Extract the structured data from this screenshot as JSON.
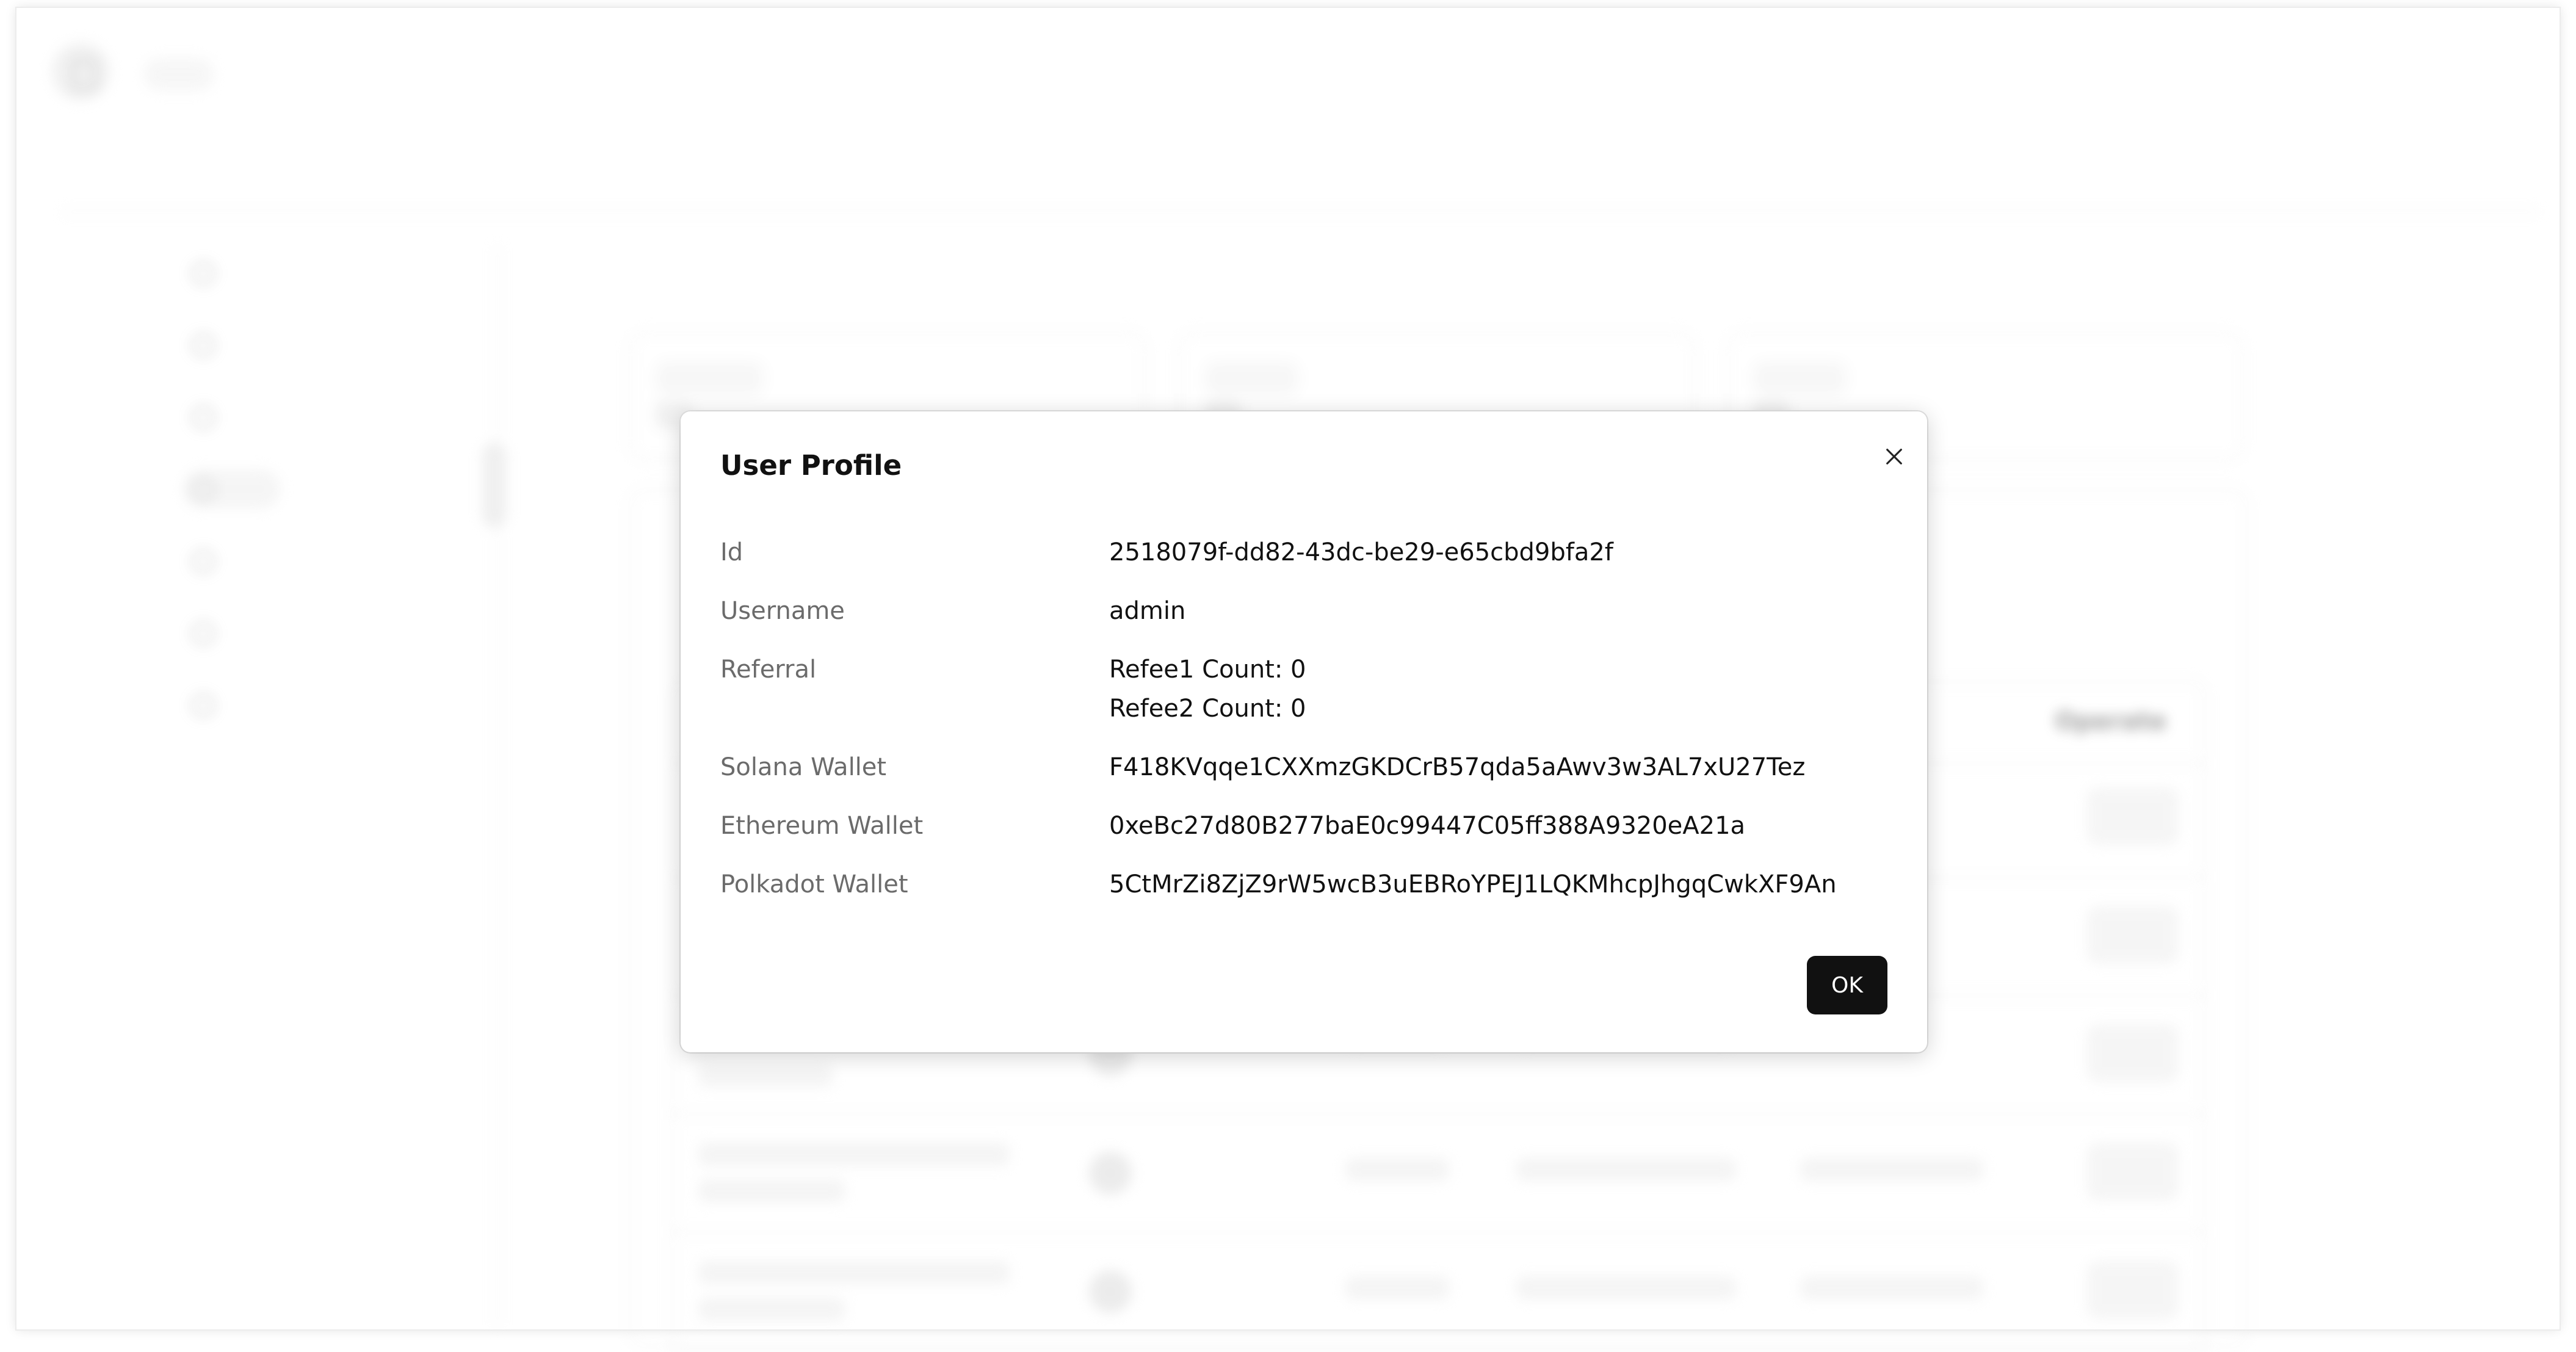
{
  "background": {
    "sidebar_item_count": 7,
    "table_operate_label": "Operate",
    "table_row_count": 5
  },
  "modal": {
    "title": "User Profile",
    "fields": [
      {
        "label": "Id",
        "value": "2518079f-dd82-43dc-be29-e65cbd9bfa2f"
      },
      {
        "label": "Username",
        "value": "admin"
      },
      {
        "label": "Referral",
        "value": "Refee1 Count: 0",
        "value2": "Refee2 Count: 0"
      },
      {
        "label": "Solana Wallet",
        "value": "F418KVqqe1CXXmzGKDCrB57qda5aAwv3w3AL7xU27Tez"
      },
      {
        "label": "Ethereum Wallet",
        "value": "0xeBc27d80B277baE0c99447C05ff388A9320eA21a"
      },
      {
        "label": "Polkadot Wallet",
        "value": "5CtMrZi8ZjZ9rW5wcB3uEBRoYPEJ1LQKMhcpJhgqCwkXF9An"
      }
    ],
    "ok_label": "OK"
  }
}
